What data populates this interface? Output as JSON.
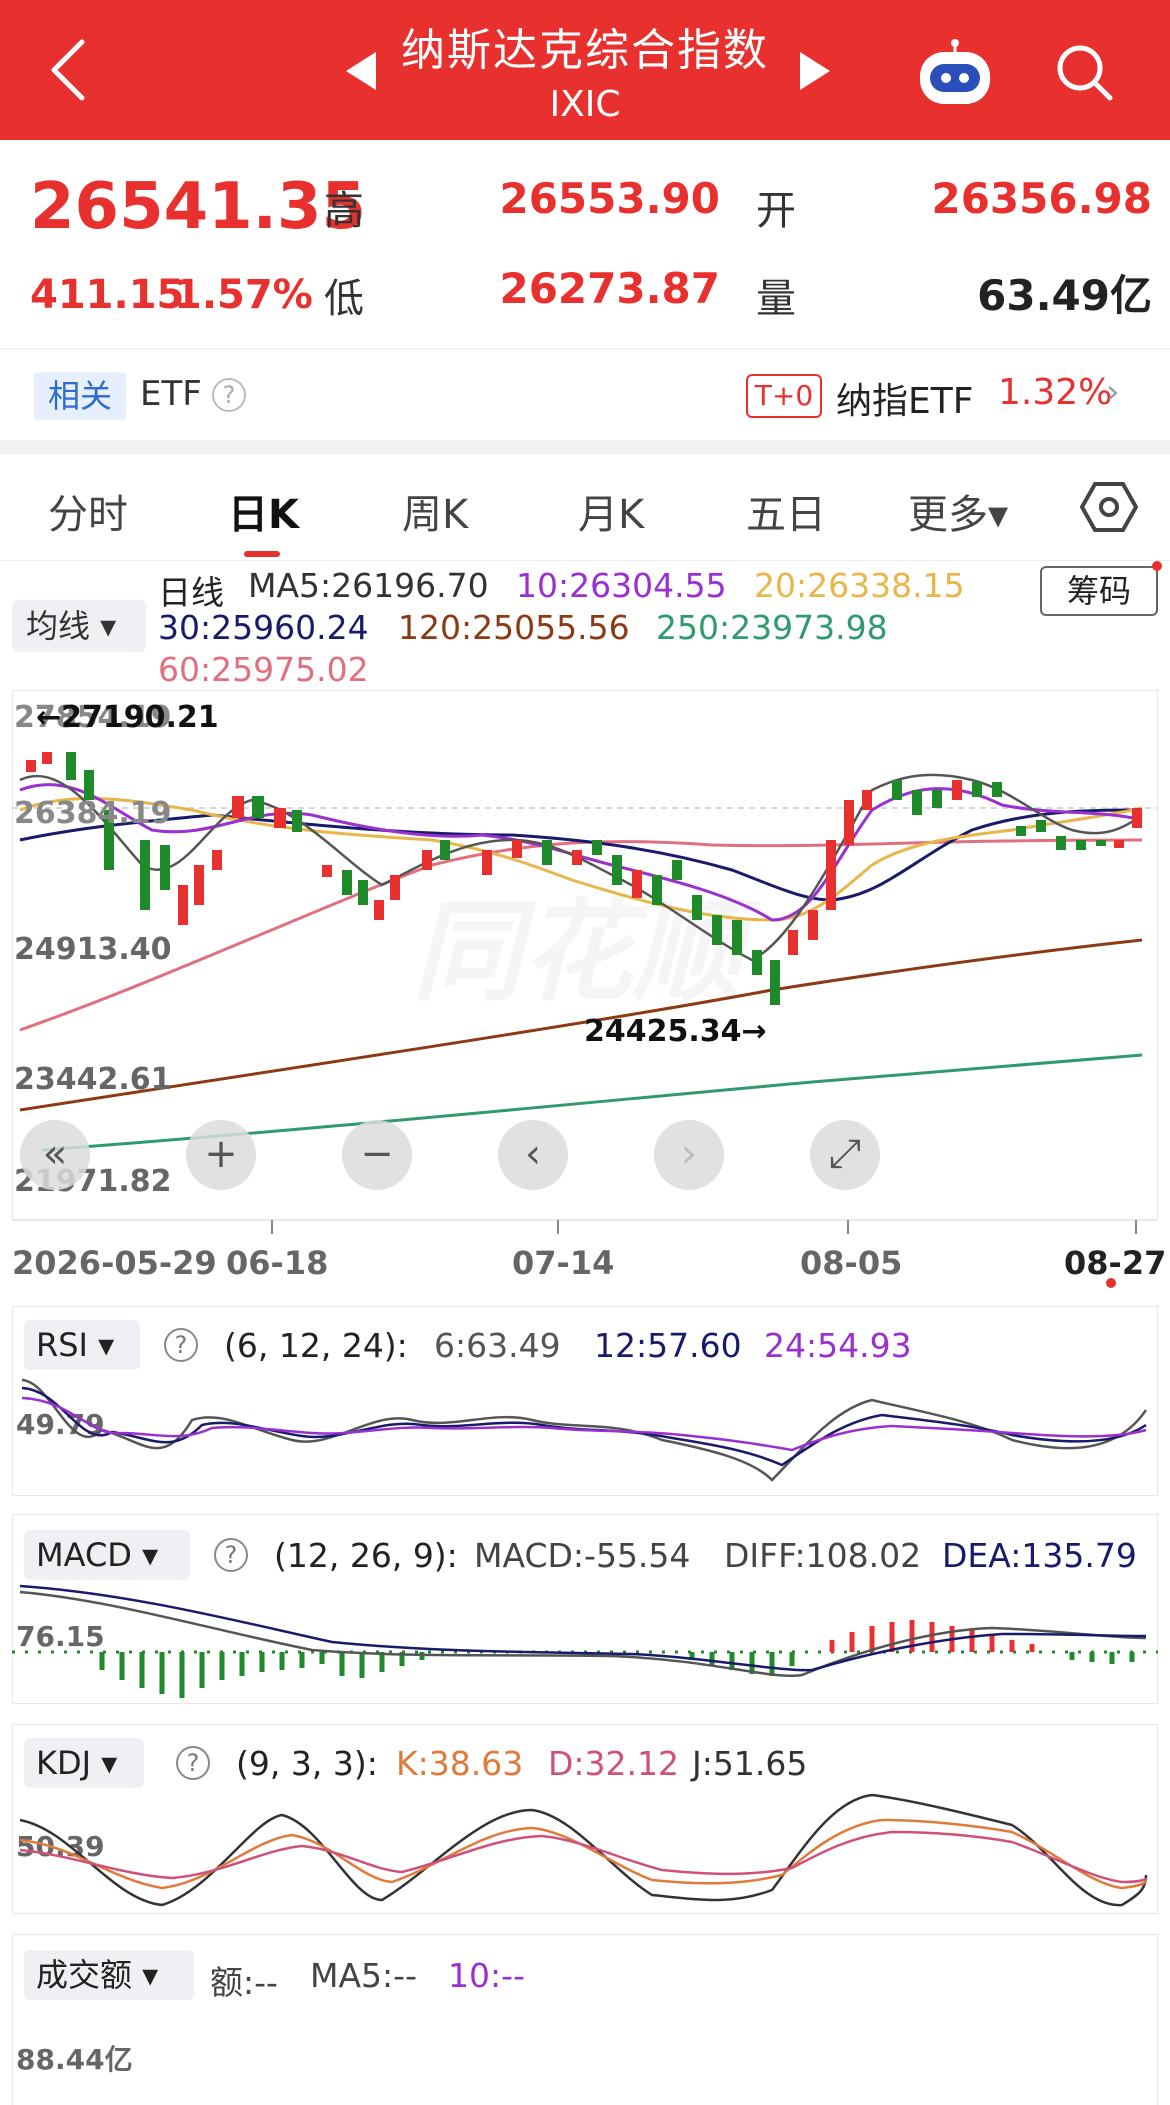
{
  "header": {
    "title": "纳斯达克综合指数",
    "subtitle": "IXIC"
  },
  "quote": {
    "price": "26541.35",
    "change": "411.15",
    "change_pct": "1.57%",
    "high_label": "高",
    "high": "26553.90",
    "open_label": "开",
    "open": "26356.98",
    "low_label": "低",
    "low": "26273.87",
    "volume_label": "量",
    "volume": "63.49亿"
  },
  "related": {
    "tag": "相关",
    "etf_label": "ETF",
    "help": "?",
    "t0_tag": "T+0",
    "etf_name": "纳指ETF",
    "etf_change": "1.32%",
    "arrow": "›"
  },
  "tabs": [
    "分时",
    "日K",
    "周K",
    "月K",
    "五日",
    "更多▾"
  ],
  "ma_legend": {
    "selector": "均线 ▾",
    "period": "日线",
    "ma5": "MA5:26196.70",
    "ma10": "10:26304.55",
    "ma20": "20:26338.15",
    "ma30": "30:25960.24",
    "ma120": "120:25055.56",
    "ma250": "250:23973.98",
    "ma60": "60:25975.02",
    "chouma": "筹码"
  },
  "kline": {
    "y_ticks": [
      "27854.19",
      "26384.19",
      "24913.40",
      "23442.61",
      "21971.82"
    ],
    "max_label": "←27190.21",
    "min_label": "24425.34→",
    "watermark": "同花顺",
    "dates": [
      "2026-05-29",
      "06-18",
      "07-14",
      "08-05",
      "08-27"
    ],
    "controls": [
      "«",
      "+",
      "−",
      "‹",
      "›",
      "⤢"
    ]
  },
  "rsi": {
    "selector": "RSI ▾",
    "params": "(6, 12, 24):",
    "v6": "6:63.49",
    "v12": "12:57.60",
    "v24": "24:54.93",
    "axis": "49.79"
  },
  "macd": {
    "selector": "MACD ▾",
    "params": "(12, 26, 9):",
    "macd": "MACD:-55.54",
    "diff": "DIFF:108.02",
    "dea": "DEA:135.79",
    "axis": "76.15"
  },
  "kdj": {
    "selector": "KDJ ▾",
    "params": "(9, 3, 3):",
    "k": "K:38.63",
    "d": "D:32.12",
    "j": "J:51.65",
    "axis": "50.39"
  },
  "turnover": {
    "selector": "成交额 ▾",
    "amount": "额:--",
    "ma5": "MA5:--",
    "ma10": "10:--",
    "axis": "88.44亿"
  },
  "colors": {
    "up": "#e8312f",
    "down": "#1e8a2a",
    "ma5": "#333333",
    "ma10": "#9b30d0",
    "ma20": "#e8b64a",
    "ma30": "#1a1a6b",
    "ma120": "#8b3a14",
    "ma250": "#2e9a6e",
    "ma60": "#e07080"
  }
}
